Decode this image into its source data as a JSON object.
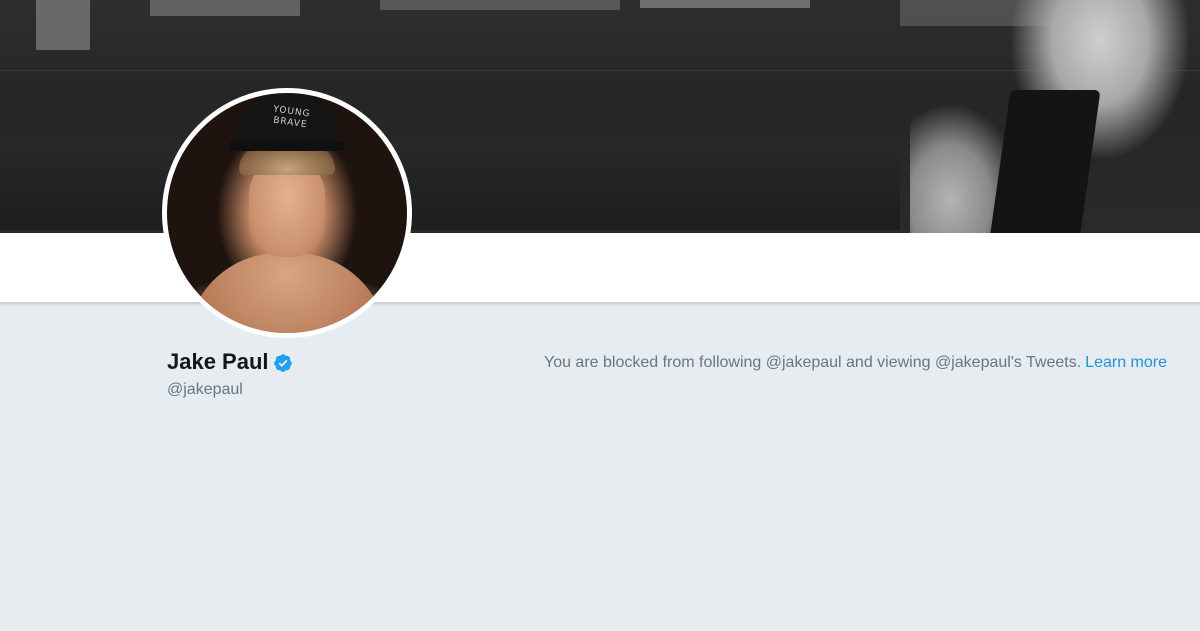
{
  "profile": {
    "display_name": "Jake Paul",
    "handle": "@jakepaul",
    "verified": true,
    "avatar_cap_text": "YOUNG BRAVE"
  },
  "blocked_notice": {
    "message": "You are blocked from following @jakepaul and viewing @jakepaul's Tweets.",
    "link_label": "Learn more"
  },
  "colors": {
    "page_background": "#e6ecf0",
    "link": "#1b95e0",
    "verified_badge": "#1da1f2",
    "secondary_text": "#657786",
    "primary_text": "#14171a"
  },
  "icons": {
    "verified": "verified-badge-icon"
  }
}
